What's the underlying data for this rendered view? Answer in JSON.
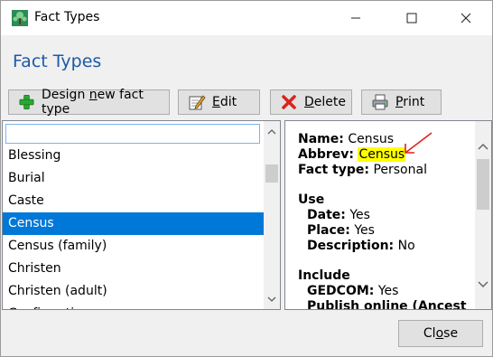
{
  "window": {
    "title": "Fact Types",
    "heading": "Fact Types"
  },
  "toolbar": {
    "design_prefix": "Design ",
    "design_mnemonic": "n",
    "design_suffix": "ew fact type",
    "edit_mnemonic": "E",
    "edit_suffix": "dit",
    "delete_mnemonic": "D",
    "delete_suffix": "elete",
    "print_mnemonic": "P",
    "print_suffix": "rint"
  },
  "list": {
    "search_value": "",
    "items": [
      "Blessing",
      "Burial",
      "Caste",
      "Census",
      "Census (family)",
      "Christen",
      "Christen (adult)",
      "Confirmation"
    ],
    "selected": "Census"
  },
  "details": {
    "name_label": "Name:",
    "name_value": "Census",
    "abbrev_label": "Abbrev:",
    "abbrev_value": "Census",
    "facttype_label": "Fact type:",
    "facttype_value": "Personal",
    "use_heading": "Use",
    "date_label": "Date:",
    "date_value": "Yes",
    "place_label": "Place:",
    "place_value": "Yes",
    "description_label": "Description:",
    "description_value": "No",
    "include_heading": "Include",
    "gedcom_label": "GEDCOM:",
    "gedcom_value": "Yes",
    "partial_label": "Publish online (Ancest"
  },
  "footer": {
    "close_prefix": "Cl",
    "close_mnemonic": "o",
    "close_suffix": "se"
  },
  "colors": {
    "heading": "#1c5aa6",
    "selection": "#0078d7",
    "highlight": "#ffff00",
    "annotation_arrow": "#e02020"
  }
}
